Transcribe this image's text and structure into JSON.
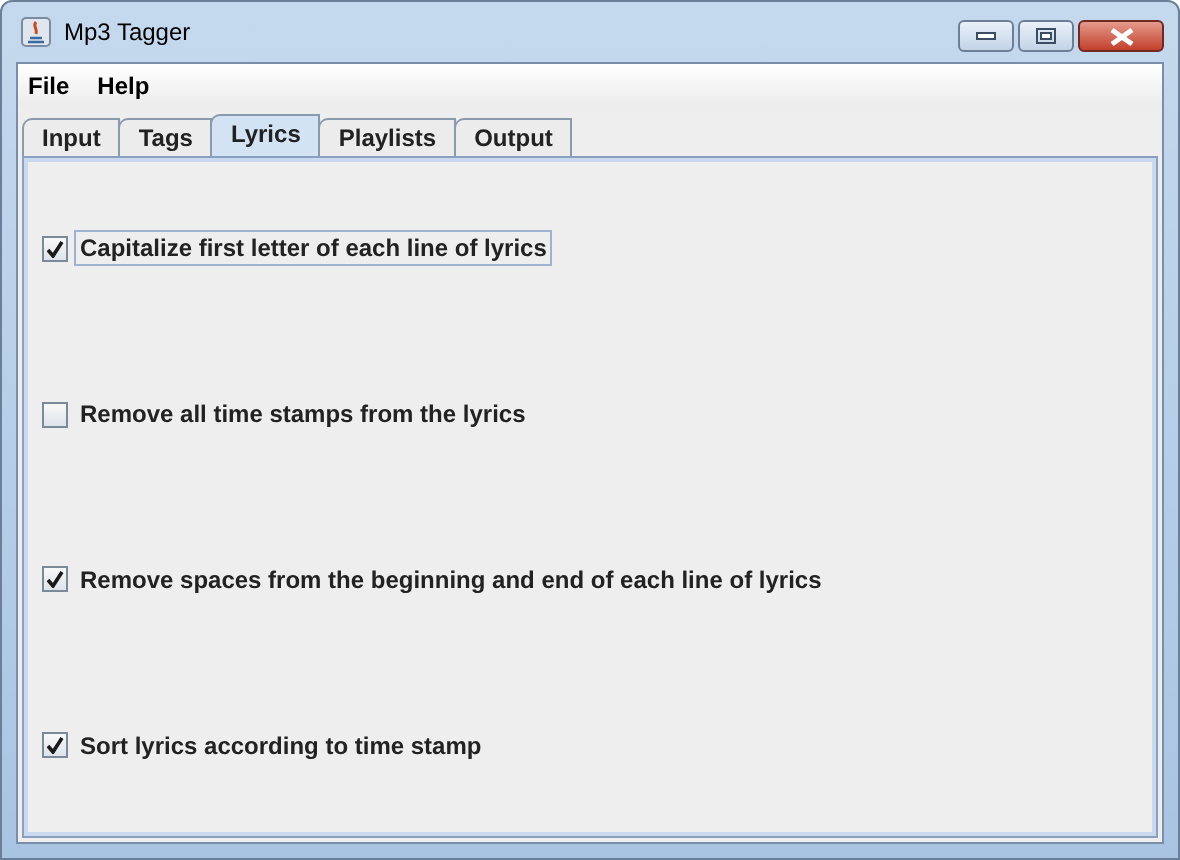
{
  "window": {
    "title": "Mp3 Tagger"
  },
  "menu": [
    {
      "label": "File"
    },
    {
      "label": "Help"
    }
  ],
  "tabs": [
    {
      "label": "Input",
      "selected": false
    },
    {
      "label": "Tags",
      "selected": false
    },
    {
      "label": "Lyrics",
      "selected": true
    },
    {
      "label": "Playlists",
      "selected": false
    },
    {
      "label": "Output",
      "selected": false
    }
  ],
  "options": [
    {
      "label": "Capitalize first letter of each line of lyrics",
      "checked": true,
      "focused": true
    },
    {
      "label": "Remove all time stamps from the lyrics",
      "checked": false,
      "focused": false
    },
    {
      "label": "Remove spaces from the beginning and end of each line of lyrics",
      "checked": true,
      "focused": false
    },
    {
      "label": "Sort lyrics according to time stamp",
      "checked": true,
      "focused": false
    }
  ]
}
